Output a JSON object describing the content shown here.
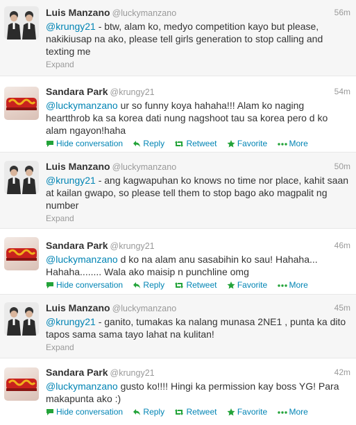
{
  "labels": {
    "expand": "Expand",
    "hide_conversation": "Hide conversation",
    "reply": "Reply",
    "retweet": "Retweet",
    "favorite": "Favorite",
    "more": "More"
  },
  "colors": {
    "link": "#0084b4",
    "favorite_icon": "#23a339",
    "muted": "#999999",
    "alt_background": "#f6f6f6"
  },
  "icons": {
    "hide": "speech-bubble-icon",
    "reply": "reply-arrow-icon",
    "retweet": "retweet-icon",
    "favorite": "star-icon",
    "more": "dots-icon"
  },
  "tweets": [
    {
      "name": "Luis Manzano",
      "handle": "@luckymanzano",
      "time": "56m",
      "mention": "@krungy21",
      "text": " - btw, alam ko, medyo competition kayo but please, nakikiusap na ako, please tell girls generation to stop calling and texting me",
      "footer": "expand"
    },
    {
      "name": "Sandara Park",
      "handle": "@krungy21",
      "time": "54m",
      "mention": "@luckymanzano",
      "text": " ur so funny koya hahaha!!! Alam ko naging heartthrob ka sa korea dati nung nagshoot tau sa korea pero d ko alam ngayon!haha",
      "footer": "actions"
    },
    {
      "name": "Luis Manzano",
      "handle": "@luckymanzano",
      "time": "50m",
      "mention": "@krungy21",
      "text": " - ang kagwapuhan ko knows no time nor place, kahit saan at kailan gwapo, so please tell them to stop bago ako magpalit ng number",
      "footer": "expand"
    },
    {
      "name": "Sandara Park",
      "handle": "@krungy21",
      "time": "46m",
      "mention": "@luckymanzano",
      "text": " d ko na alam anu sasabihin ko sau! Hahaha... Hahaha........ Wala ako maisip n punchline omg",
      "footer": "actions"
    },
    {
      "name": "Luis Manzano",
      "handle": "@luckymanzano",
      "time": "45m",
      "mention": "@krungy21",
      "text": " - ganito, tumakas ka nalang munasa 2NE1 , punta ka dito tapos sama sama tayo lahat na kulitan!",
      "footer": "expand"
    },
    {
      "name": "Sandara Park",
      "handle": "@krungy21",
      "time": "42m",
      "mention": "@luckymanzano",
      "text": " gusto ko!!!! Hingi ka permission kay boss YG! Para makapunta ako :)",
      "footer": "actions"
    }
  ]
}
